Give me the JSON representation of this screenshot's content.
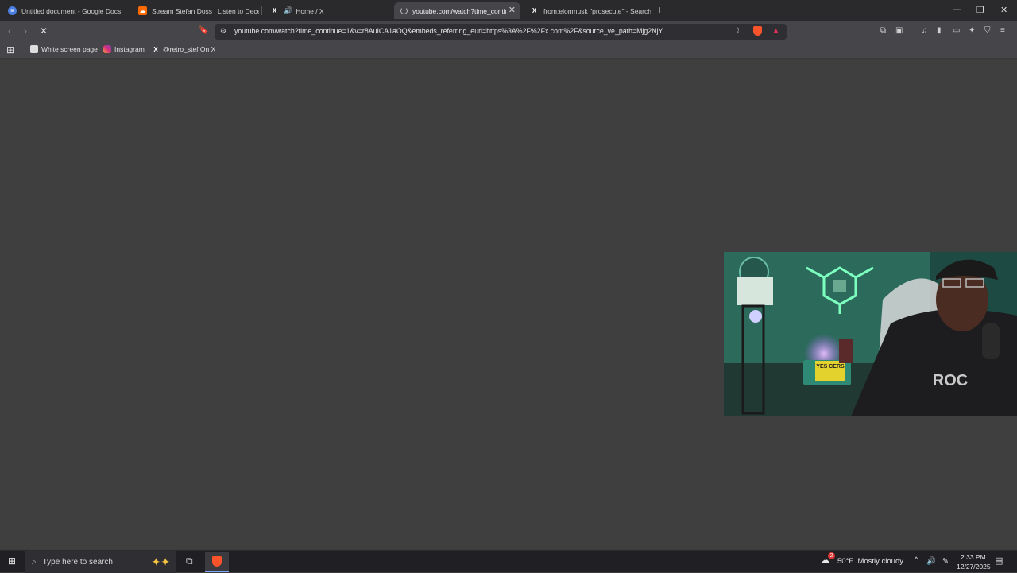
{
  "tabs": [
    {
      "title": "Untitled document - Google Docs",
      "icon": "google-docs-icon",
      "active": false
    },
    {
      "title": "Stream Stefan Doss | Listen to Decen",
      "icon": "soundcloud-icon",
      "active": false
    },
    {
      "title": "Home / X",
      "icon": "x-icon",
      "active": false
    },
    {
      "title": "youtube.com/watch?time_contin",
      "icon": "loading-icon",
      "active": true
    },
    {
      "title": "from:elonmusk \"prosecute\" - Search",
      "icon": "x-icon",
      "active": false
    }
  ],
  "address_bar": {
    "url": "youtube.com/watch?time_continue=1&v=r8AuICA1aOQ&embeds_referring_euri=https%3A%2F%2Fx.com%2F&source_ve_path=Mjg2NjY"
  },
  "bookmarks": [
    {
      "label": "White screen page",
      "icon": "page-icon"
    },
    {
      "label": "Instagram",
      "icon": "instagram-icon"
    },
    {
      "label": "@retro_stef On X",
      "icon": "x-icon"
    }
  ],
  "taskbar": {
    "search_placeholder": "Type here to search",
    "weather": "50°F  Mostly cloudy",
    "weather_badge": "2",
    "time": "2:33 PM",
    "date": "12/27/2025"
  },
  "webcam_overlay": {
    "sign_text": "YES CERS",
    "shirt_text": "ROC"
  },
  "colors": {
    "tab_bar": "#2a2a2d",
    "toolbar": "#45454a",
    "content": "#3f3f3f",
    "taskbar": "#202024",
    "accent_green": "#3dff9a"
  }
}
